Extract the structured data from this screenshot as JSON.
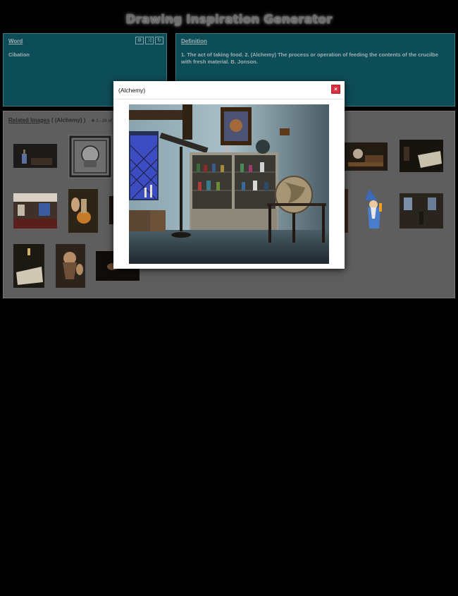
{
  "app": {
    "title": "Drawing Inspiration Generator"
  },
  "word_panel": {
    "title": "Word",
    "word": "Cibation",
    "buttons": [
      {
        "icon": "settings-icon",
        "glyph": "⚙"
      },
      {
        "icon": "shuffle-icon",
        "glyph": "⤨"
      },
      {
        "icon": "refresh-icon",
        "glyph": "↻"
      }
    ]
  },
  "definition_panel": {
    "title": "Definition",
    "text": "1. The act of taking food. 2. (Alchemy) The process or operation of feeding the contents of the crucilbe with fresh material. B. Jonson."
  },
  "images_panel": {
    "title": "Related Images",
    "query": "( (Alchemy) )",
    "count": "1 - 20 of"
  },
  "modal": {
    "title": "(Alchemy)",
    "close_label": "×",
    "image_caption": "Alchemist laboratory with shelves of bottles, window, and globe"
  },
  "colors": {
    "panel_teal": "#0d4d57",
    "close_red": "#d6303d",
    "title_glow": "#9a9a9a"
  }
}
